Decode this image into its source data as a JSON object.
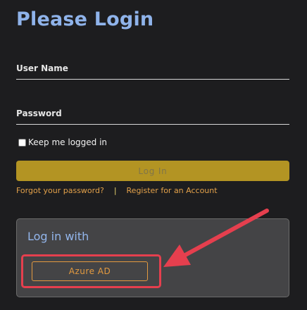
{
  "title": "Please Login",
  "username": {
    "label": "User Name",
    "value": ""
  },
  "password": {
    "label": "Password",
    "value": ""
  },
  "remember": {
    "label": "Keep me logged in",
    "checked": false
  },
  "login_button": "Log In",
  "links": {
    "forgot": "Forgot your password?",
    "separator": "|",
    "register": "Register for an Account"
  },
  "external_login": {
    "heading": "Log in with",
    "providers": [
      "Azure AD"
    ]
  },
  "colors": {
    "background": "#1d1d1f",
    "title": "#8fb3ea",
    "login_button": "#b39423",
    "link": "#e3a14a",
    "panel": "#444446",
    "annotation": "#e53f4e"
  },
  "icons": {
    "annotation": "arrow-icon"
  }
}
